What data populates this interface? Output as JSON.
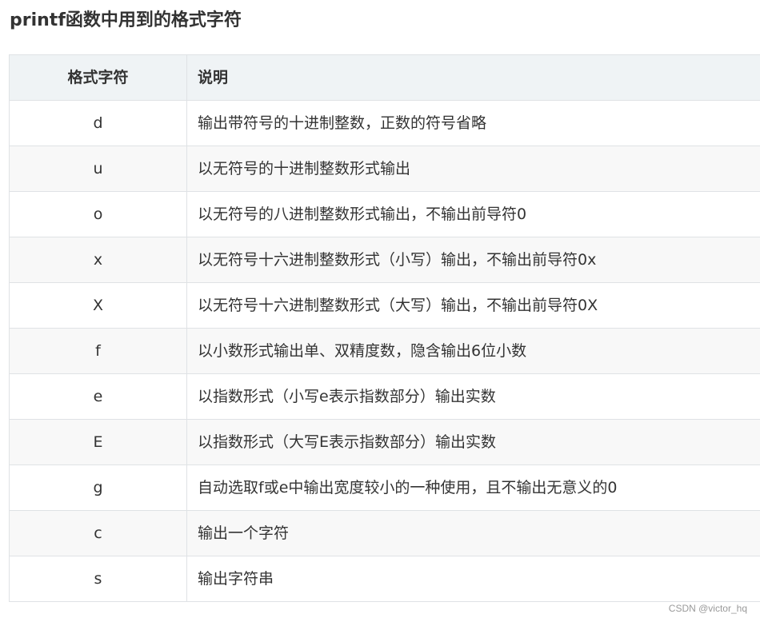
{
  "heading": "printf函数中用到的格式字符",
  "table": {
    "headers": {
      "code": "格式字符",
      "desc": "说明"
    },
    "rows": [
      {
        "code": "d",
        "desc": "输出带符号的十进制整数，正数的符号省略"
      },
      {
        "code": "u",
        "desc": "以无符号的十进制整数形式输出"
      },
      {
        "code": "o",
        "desc": "以无符号的八进制整数形式输出，不输出前导符0"
      },
      {
        "code": "x",
        "desc": "以无符号十六进制整数形式（小写）输出，不输出前导符0x"
      },
      {
        "code": "X",
        "desc": "以无符号十六进制整数形式（大写）输出，不输出前导符0X"
      },
      {
        "code": "f",
        "desc": "以小数形式输出单、双精度数，隐含输出6位小数"
      },
      {
        "code": "e",
        "desc": "以指数形式（小写e表示指数部分）输出实数"
      },
      {
        "code": "E",
        "desc": "以指数形式（大写E表示指数部分）输出实数"
      },
      {
        "code": "g",
        "desc": "自动选取f或e中输出宽度较小的一种使用，且不输出无意义的0"
      },
      {
        "code": "c",
        "desc": "输出一个字符"
      },
      {
        "code": "s",
        "desc": "输出字符串"
      }
    ]
  },
  "watermark": "CSDN @victor_hq",
  "colors": {
    "header_bg": "#eff3f5",
    "stripe_bg": "#f8f8f8",
    "border": "#dfe2e5",
    "text": "#333333"
  }
}
